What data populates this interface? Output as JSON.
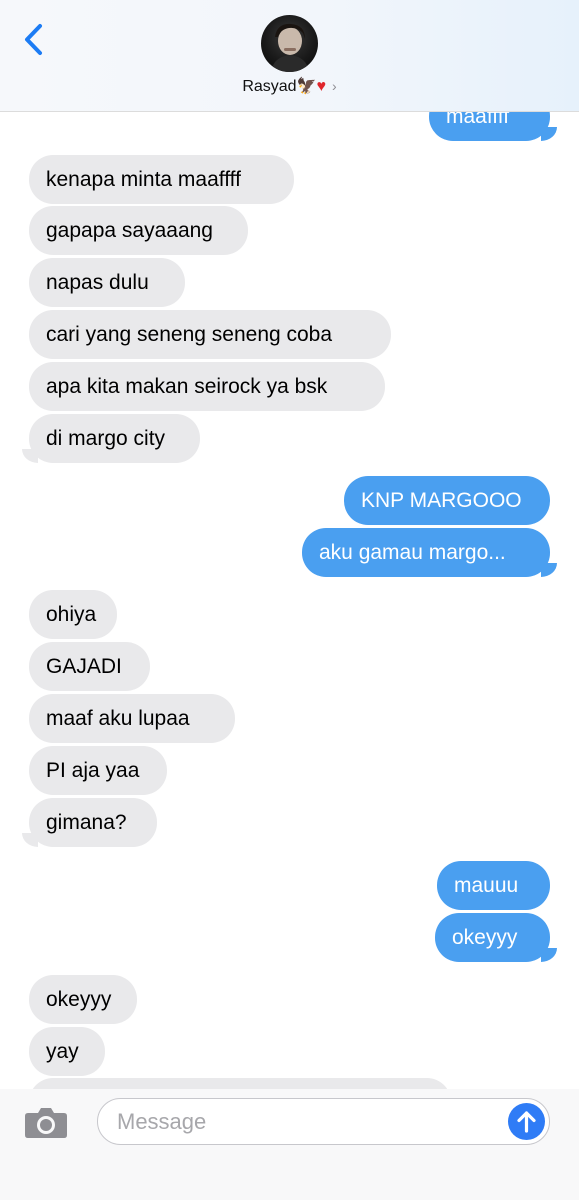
{
  "header": {
    "contact_name": "Rasyad",
    "contact_emoji": "🦅",
    "contact_heart": "♥",
    "chevron": "›"
  },
  "messages": [
    {
      "side": "sent",
      "text": "maaffff"
    },
    {
      "side": "received",
      "text": "kenapa minta maaffff"
    },
    {
      "side": "received",
      "text": "gapapa sayaaang"
    },
    {
      "side": "received",
      "text": "napas dulu"
    },
    {
      "side": "received",
      "text": "cari yang seneng seneng coba"
    },
    {
      "side": "received",
      "text": "apa kita makan seirock ya bsk"
    },
    {
      "side": "received",
      "text": "di margo city"
    },
    {
      "side": "sent",
      "text": "KNP MARGOOO"
    },
    {
      "side": "sent",
      "text": "aku gamau margo..."
    },
    {
      "side": "received",
      "text": "ohiya"
    },
    {
      "side": "received",
      "text": "GAJADI"
    },
    {
      "side": "received",
      "text": "maaf aku lupaa"
    },
    {
      "side": "received",
      "text": "PI aja yaa"
    },
    {
      "side": "received",
      "text": "gimana?"
    },
    {
      "side": "sent",
      "text": "mauuu"
    },
    {
      "side": "sent",
      "text": "okeyyy"
    },
    {
      "side": "received",
      "text": "okeyyy"
    },
    {
      "side": "received",
      "text": "yay"
    }
  ],
  "composer": {
    "placeholder": "Message"
  },
  "colors": {
    "sent_bubble": "#4a9ff0",
    "received_bubble": "#e9e9eb",
    "accent": "#2f7cf6"
  }
}
